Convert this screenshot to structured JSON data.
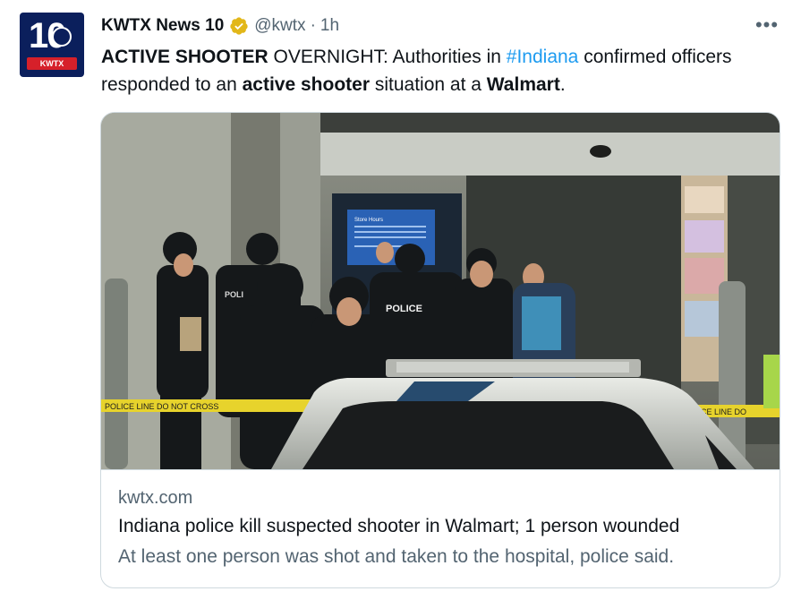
{
  "account": {
    "name": "KWTX News 10",
    "handle": "@kwtx",
    "separator": "·",
    "time": "1h",
    "avatar_text": "10",
    "avatar_band": "KWTX"
  },
  "more_menu": "•••",
  "tweet": {
    "part1_bold": "ACTIVE SHOOTER",
    "part2": " OVERNIGHT:  Authorities in ",
    "hashtag": "#Indiana",
    "part3": " confirmed officers responded to an ",
    "part4_bold": "active shooter",
    "part5": " situation at a ",
    "part6_bold": "Walmart",
    "part7": "."
  },
  "card": {
    "domain": "kwtx.com",
    "title": "Indiana police kill suspected shooter in Walmart; 1 person wounded",
    "description": "At least one person was shot and taken to the hospital, police said."
  },
  "photo": {
    "vest_label": "POLICE",
    "patch_label": "POLI",
    "tape_text_left": "POLICE LINE DO NOT CROSS",
    "tape_text_right": "CE LINE DO",
    "sign_title": "Store Hours"
  },
  "colors": {
    "link": "#1d9bf0",
    "secondary_text": "#536471",
    "verified_gold": "#e2b719",
    "avatar_bg": "#0b1f5c",
    "avatar_band": "#d6202a"
  },
  "icons": {
    "verified": "verified-badge-icon",
    "more": "more-horizontal-icon"
  }
}
